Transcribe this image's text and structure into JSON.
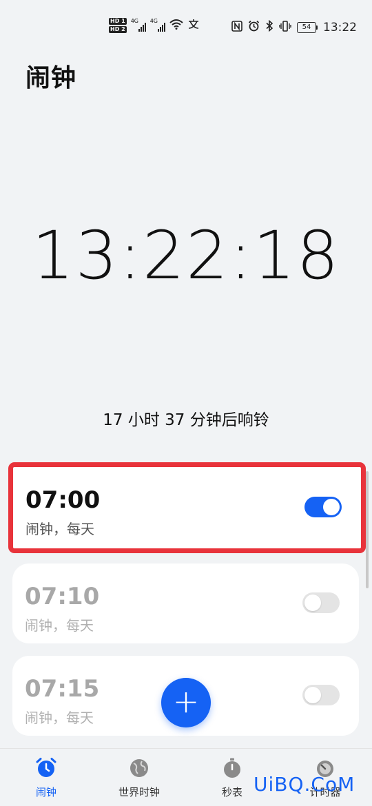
{
  "status_bar": {
    "hd1": "HD 1",
    "hd2": "HD 2",
    "net1": "4G",
    "net2": "4G",
    "battery": "54",
    "time": "13:22"
  },
  "app": {
    "title": "闹钟",
    "current_time": "13:22:18",
    "next_alarm_text": "17 小时 37 分钟后响铃"
  },
  "alarms": [
    {
      "time": "07:00",
      "label": "闹钟，每天",
      "enabled": true
    },
    {
      "time": "07:10",
      "label": "闹钟，每天",
      "enabled": false
    },
    {
      "time": "07:15",
      "label": "闹钟，每天",
      "enabled": false
    }
  ],
  "fab": {
    "label": "+"
  },
  "bottom_nav": [
    {
      "label": "闹钟",
      "icon": "alarm-clock-icon",
      "active": true
    },
    {
      "label": "世界时钟",
      "icon": "globe-icon",
      "active": false
    },
    {
      "label": "秒表",
      "icon": "stopwatch-icon",
      "active": false
    },
    {
      "label": "计时器",
      "icon": "timer-icon",
      "active": false
    }
  ],
  "watermark": "UiBQ.CoM",
  "colors": {
    "accent": "#1562f4",
    "highlight": "#e8333b",
    "background": "#f1f3f5"
  }
}
